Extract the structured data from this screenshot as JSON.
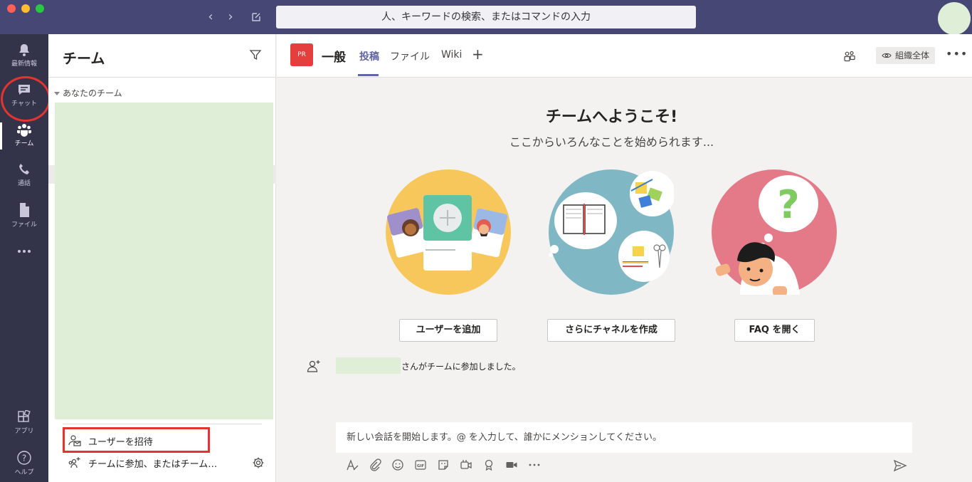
{
  "titlebar": {
    "search_placeholder": "人、キーワードの検索、またはコマンドの入力"
  },
  "rail": {
    "items": [
      {
        "label": "最新情報",
        "icon": "bell-icon"
      },
      {
        "label": "チャット",
        "icon": "chat-icon"
      },
      {
        "label": "チーム",
        "icon": "teams-icon",
        "active": true
      },
      {
        "label": "通話",
        "icon": "phone-icon"
      },
      {
        "label": "ファイル",
        "icon": "file-icon"
      },
      {
        "label": "",
        "icon": "more-icon"
      }
    ],
    "bottom": [
      {
        "label": "アプリ",
        "icon": "apps-icon"
      },
      {
        "label": "ヘルプ",
        "icon": "help-icon"
      }
    ]
  },
  "panel": {
    "title": "チーム",
    "section_label": "あなたのチーム",
    "invite_label": "ユーザーを招待",
    "join_label": "チームに参加、またはチーム…"
  },
  "channel": {
    "avatar_initials": "PR",
    "name": "一般",
    "tabs": [
      "投稿",
      "ファイル",
      "Wiki"
    ],
    "active_tab": "投稿",
    "org_label": "組織全体"
  },
  "welcome": {
    "title": "チームへようこそ!",
    "subtitle": "ここからいろんなことを始められます...",
    "buttons": {
      "add_user": "ユーザーを追加",
      "create_channel": "さらにチャネルを作成",
      "faq": "FAQ を開く"
    }
  },
  "activity": {
    "text": "さんがチームに参加しました。"
  },
  "compose": {
    "placeholder": "新しい会話を開始します。@ を入力して、誰かにメンションしてください。"
  },
  "colors": {
    "titlebar": "#464775",
    "rail": "#33344a",
    "accent": "#6264a7",
    "highlight_red": "#e3342f",
    "redaction": "#dfeed6"
  }
}
